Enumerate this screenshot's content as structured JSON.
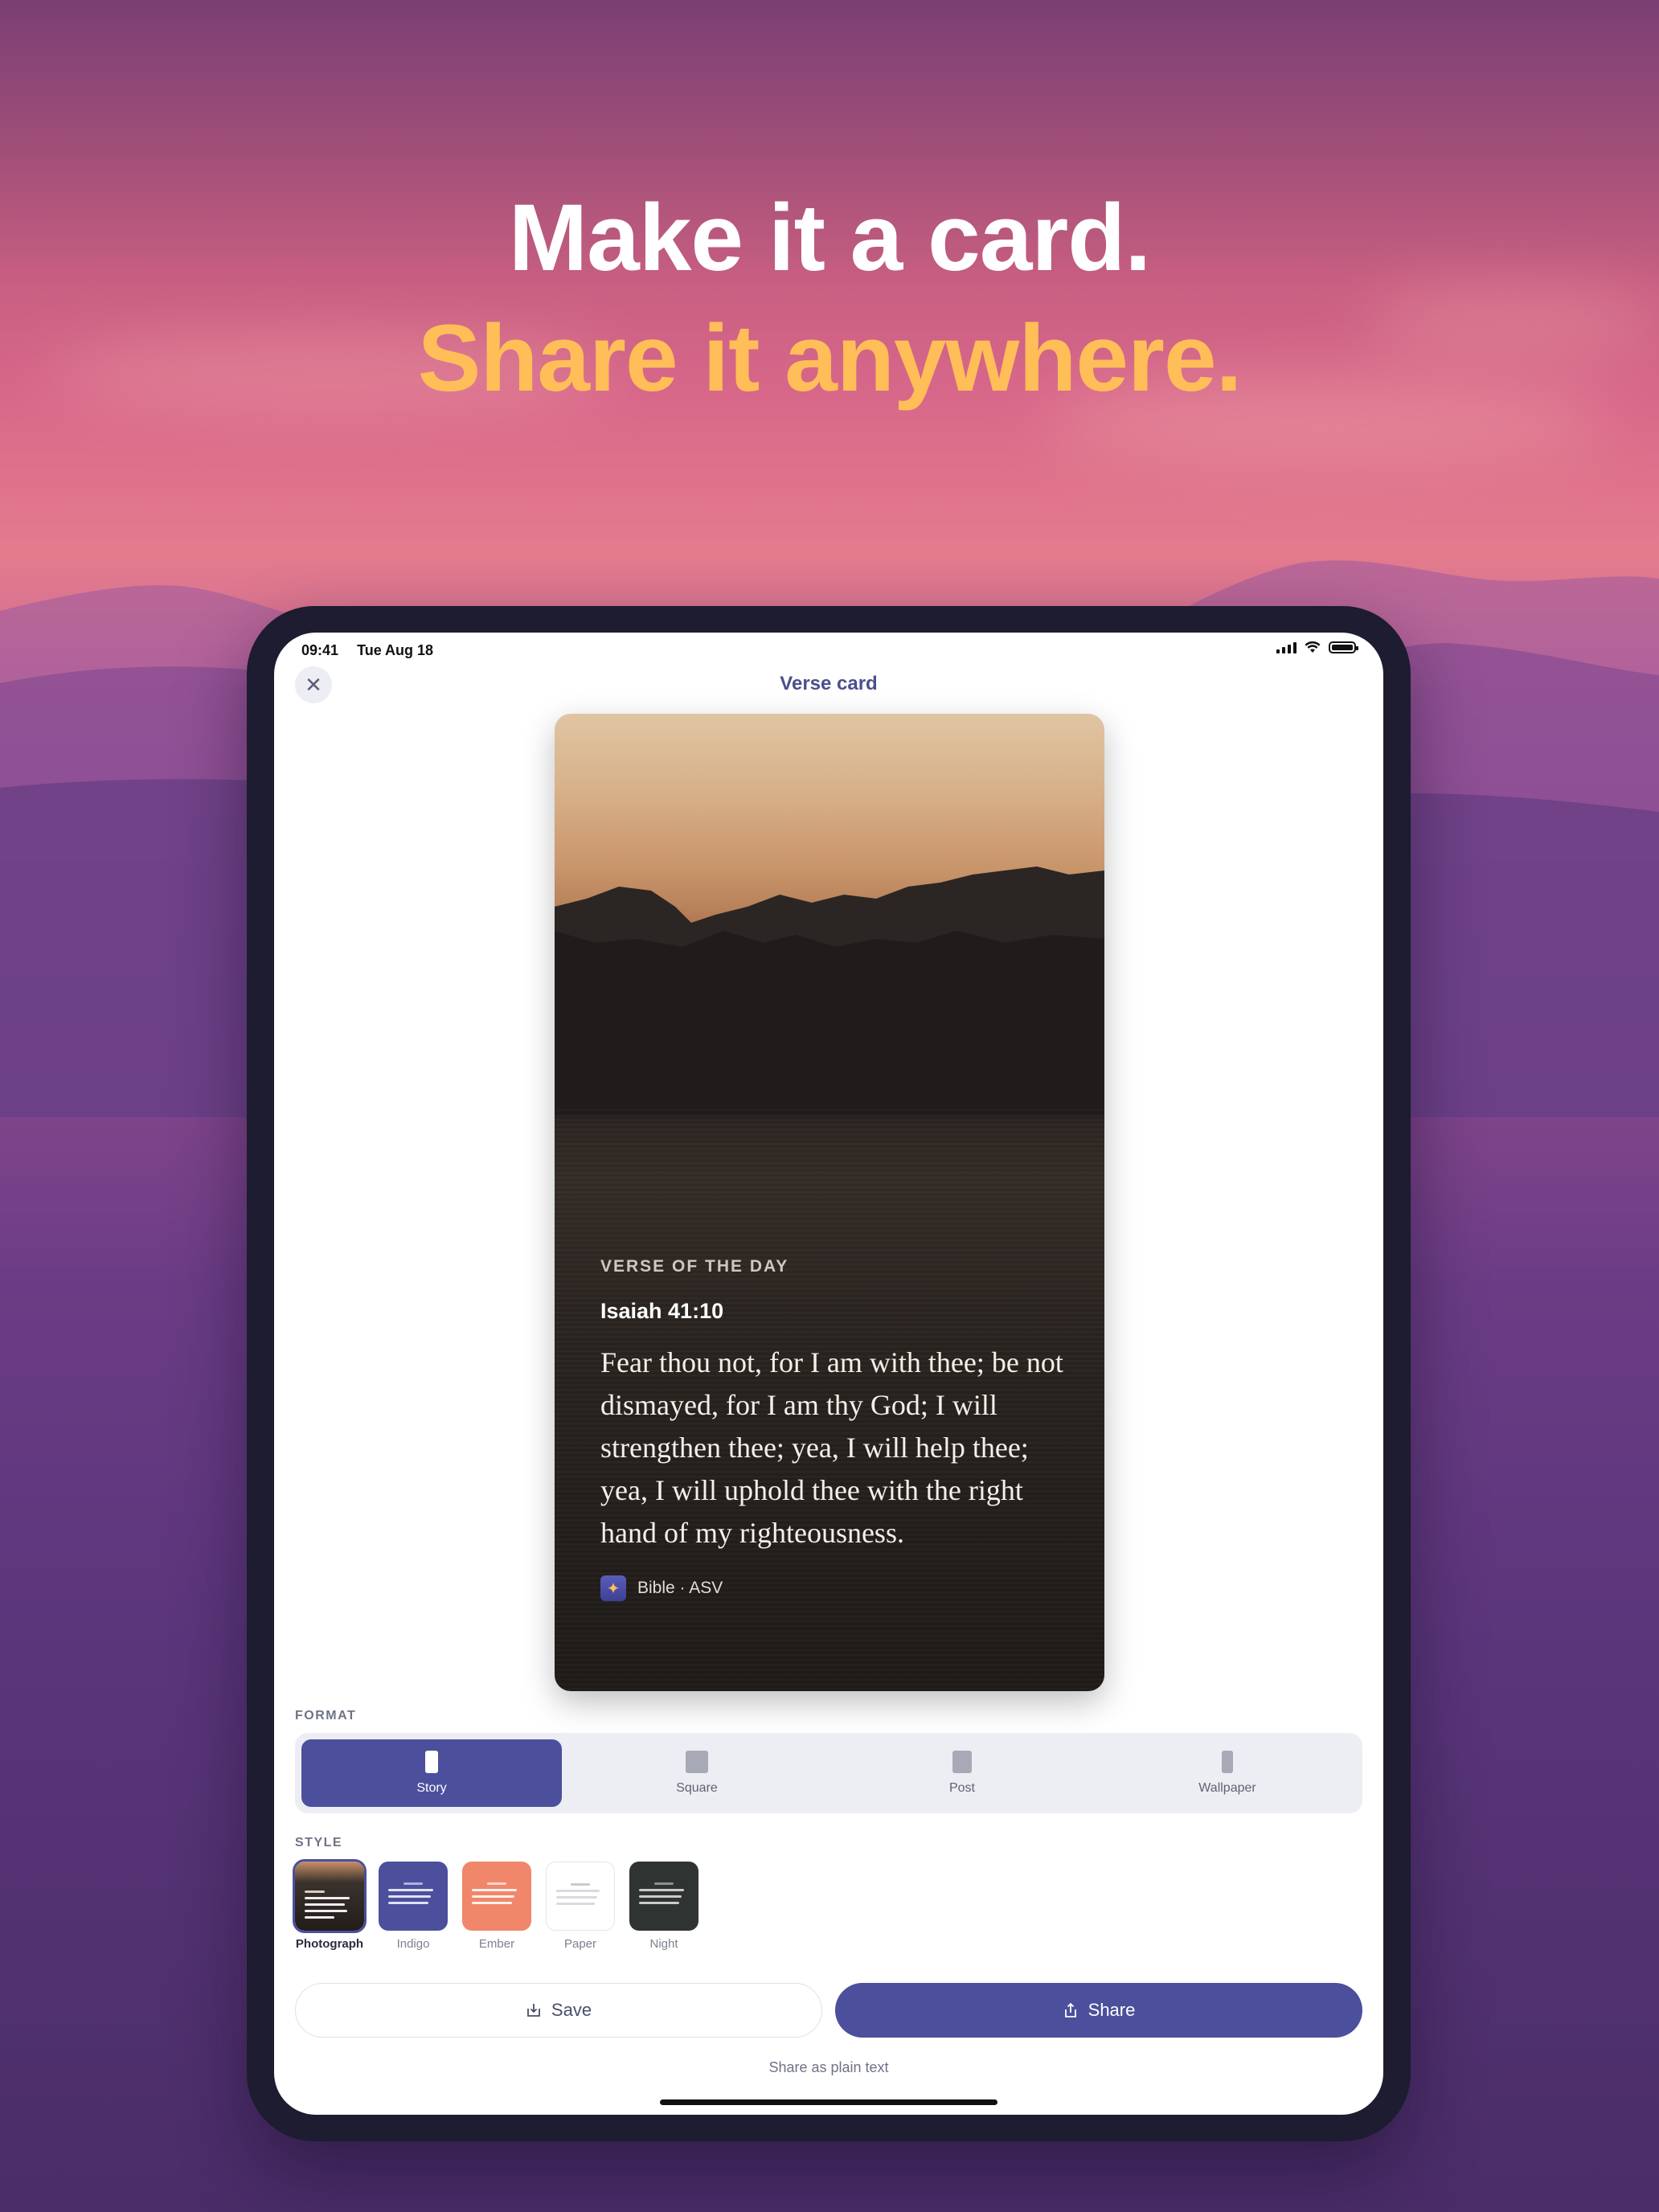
{
  "hero": {
    "line1": "Make it a card.",
    "line2": "Share it anywhere."
  },
  "status_bar": {
    "time": "09:41",
    "date": "Tue Aug 18"
  },
  "header": {
    "title": "Verse card",
    "close_icon": "close-icon"
  },
  "card": {
    "eyebrow": "VERSE OF THE DAY",
    "reference": "Isaiah 41:10",
    "verse": "Fear thou not, for I am with thee; be not dismayed, for I am thy God; I will strengthen thee; yea, I will help thee; yea, I will uphold thee with the right hand of my righteousness.",
    "brand": "Bible · ASV"
  },
  "format": {
    "label": "FORMAT",
    "options": [
      {
        "label": "Story",
        "selected": true
      },
      {
        "label": "Square",
        "selected": false
      },
      {
        "label": "Post",
        "selected": false
      },
      {
        "label": "Wallpaper",
        "selected": false
      }
    ]
  },
  "style": {
    "label": "STYLE",
    "options": [
      {
        "label": "Photograph",
        "selected": true,
        "color": "#2a2320"
      },
      {
        "label": "Indigo",
        "selected": false,
        "color": "#4b4f9c"
      },
      {
        "label": "Ember",
        "selected": false,
        "color": "#f0876a"
      },
      {
        "label": "Paper",
        "selected": false,
        "color": "#ffffff"
      },
      {
        "label": "Night",
        "selected": false,
        "color": "#2f3331"
      }
    ]
  },
  "actions": {
    "save_label": "Save",
    "share_label": "Share",
    "plain_text_label": "Share as plain text"
  },
  "colors": {
    "accent": "#4b4f9c",
    "headline_highlight": "#ffbe58"
  }
}
